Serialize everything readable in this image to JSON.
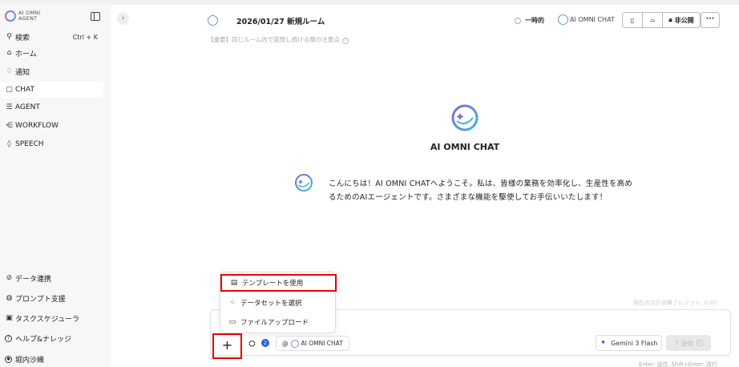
{
  "app": {
    "logo_text_line1": "AI OMNI",
    "logo_text_line2": "AGENT"
  },
  "sidebar": {
    "search": {
      "label": "検索",
      "shortcut": "Ctrl + K"
    },
    "items": [
      {
        "label": "ホーム",
        "icon": "home-icon",
        "glyph": "⌂"
      },
      {
        "label": "通知",
        "icon": "bell-icon",
        "glyph": "♫"
      },
      {
        "label": "CHAT",
        "icon": "chat-icon",
        "glyph": "▢"
      },
      {
        "label": "AGENT",
        "icon": "agent-icon",
        "glyph": "☰"
      },
      {
        "label": "WORKFLOW",
        "icon": "workflow-icon",
        "glyph": "⋲"
      },
      {
        "label": "SPEECH",
        "icon": "mic-icon",
        "glyph": "◊"
      }
    ],
    "bottom_items": [
      {
        "label": "データ連携",
        "icon": "link-icon",
        "glyph": "⌘"
      },
      {
        "label": "プロンプト支援",
        "icon": "prompt-icon",
        "glyph": "◍"
      },
      {
        "label": "タスクスケジューラ",
        "icon": "calendar-icon",
        "glyph": "▣"
      },
      {
        "label": "ヘルプ&ナレッジ",
        "icon": "help-icon",
        "glyph": "?"
      },
      {
        "label": "堀内沙織",
        "icon": "user-icon",
        "glyph": "●"
      }
    ]
  },
  "header": {
    "room_title": "2026/01/27 新規ルーム",
    "notice": "【重要】同じルーム内で質問し続ける際の注意点",
    "temporary_label": "一時的",
    "model_name": "AI OMNI CHAT",
    "visibility_label": "非公開",
    "more_label": "···"
  },
  "main": {
    "hero_title": "AI OMNI CHAT",
    "welcome_message": "こんにちは！AI OMNI CHATへようこそ。私は、皆様の業務を効率化し、生産性を高めるためのAIエージェントです。さまざまな機能を駆使してお手伝いいたします！"
  },
  "composer": {
    "credits": "現在の合計消費クレジット: 0.00",
    "plus_label": "+",
    "dataset_count": "2",
    "mention_prefix": "@",
    "mention_model": "AI OMNI CHAT",
    "model_select": "Gemini 3 Flash",
    "send_label": "↑ 送信",
    "hint": "Enter: 送信, Shift+Enter: 改行"
  },
  "menu": {
    "items": [
      {
        "label": "テンプレートを使用",
        "icon": "template-icon",
        "glyph": "▤"
      },
      {
        "label": "データセットを選択",
        "icon": "dataset-icon",
        "glyph": "⁘"
      },
      {
        "label": "ファイルアップロード",
        "icon": "folder-icon",
        "glyph": "▭"
      }
    ]
  },
  "colors": {
    "accent_purple": "#8a7bd8",
    "accent_cyan": "#4ab0d8",
    "highlight_red": "#e00000",
    "badge_blue": "#2d5be3"
  }
}
